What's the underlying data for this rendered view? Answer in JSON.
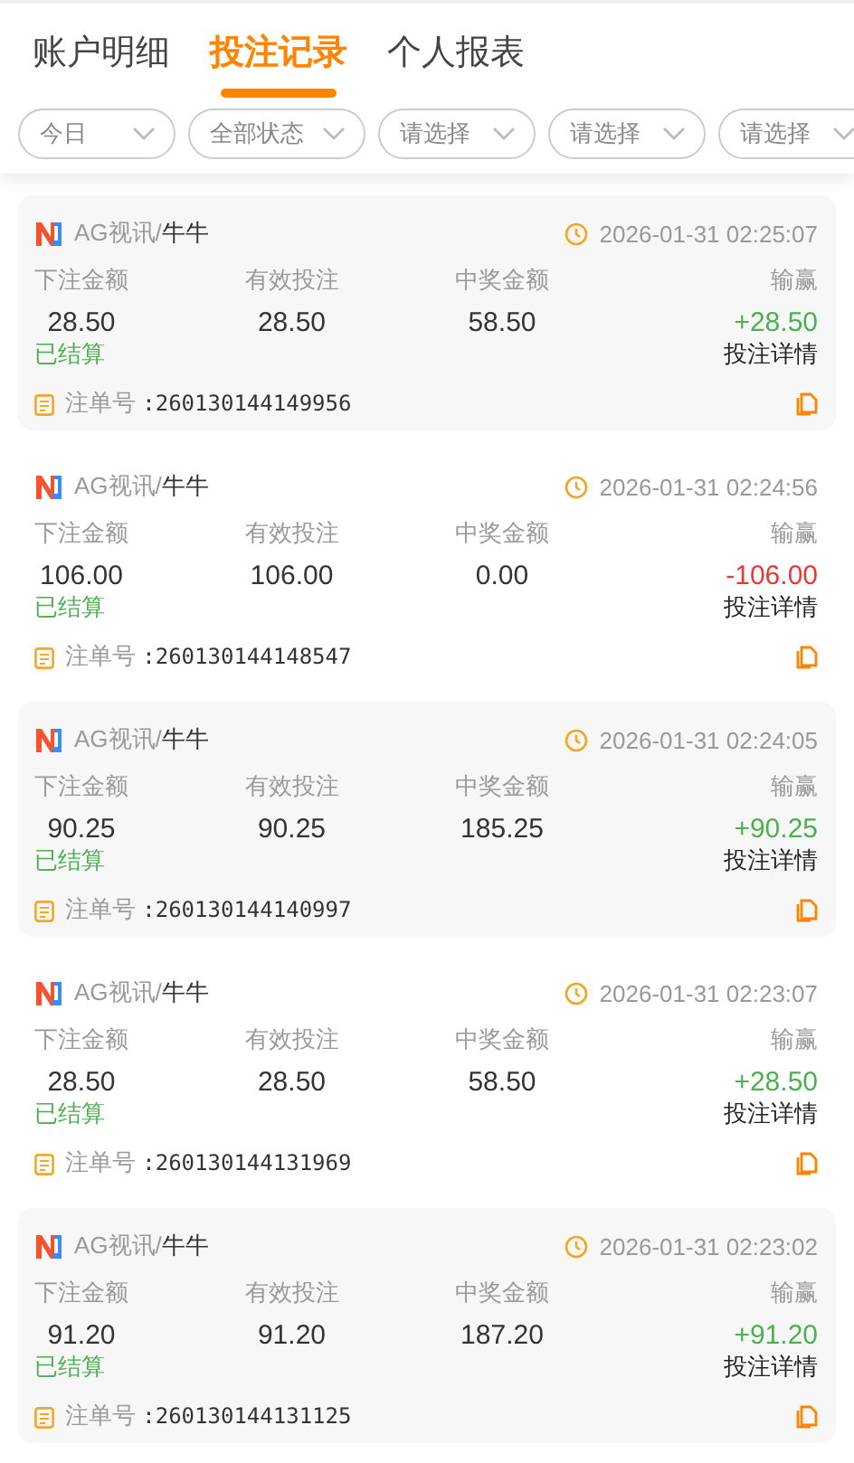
{
  "tabs": [
    {
      "label": "账户明细",
      "selected": false
    },
    {
      "label": "投注记录",
      "selected": true
    },
    {
      "label": "个人报表",
      "selected": false
    }
  ],
  "filters": [
    "今日",
    "全部状态",
    "请选择",
    "请选择",
    "请选择"
  ],
  "records": [
    {
      "game": "AG视讯/",
      "table": "牛牛",
      "time": "2026-01-31 02:25:07",
      "labels": [
        "下注金额",
        "有效投注",
        "中奖金额",
        "输赢"
      ],
      "bet": "28.50",
      "valid": "28.50",
      "payout": "58.50",
      "result": "+28.50",
      "kind": "win",
      "status": "已结算",
      "detail": "投注详情",
      "order_label": "注单号",
      "order_no": ":260130144149956"
    },
    {
      "game": "AG视讯/",
      "table": "牛牛",
      "time": "2026-01-31 02:24:56",
      "labels": [
        "下注金额",
        "有效投注",
        "中奖金额",
        "输赢"
      ],
      "bet": "106.00",
      "valid": "106.00",
      "payout": "0.00",
      "result": "-106.00",
      "kind": "loss",
      "status": "已结算",
      "detail": "投注详情",
      "order_label": "注单号",
      "order_no": ":260130144148547"
    },
    {
      "game": "AG视讯/",
      "table": "牛牛",
      "time": "2026-01-31 02:24:05",
      "labels": [
        "下注金额",
        "有效投注",
        "中奖金额",
        "输赢"
      ],
      "bet": "90.25",
      "valid": "90.25",
      "payout": "185.25",
      "result": "+90.25",
      "kind": "win",
      "status": "已结算",
      "detail": "投注详情",
      "order_label": "注单号",
      "order_no": ":260130144140997"
    },
    {
      "game": "AG视讯/",
      "table": "牛牛",
      "time": "2026-01-31 02:23:07",
      "labels": [
        "下注金额",
        "有效投注",
        "中奖金额",
        "输赢"
      ],
      "bet": "28.50",
      "valid": "28.50",
      "payout": "58.50",
      "result": "+28.50",
      "kind": "win",
      "status": "已结算",
      "detail": "投注详情",
      "order_label": "注单号",
      "order_no": ":260130144131969"
    },
    {
      "game": "AG视讯/",
      "table": "牛牛",
      "time": "2026-01-31 02:23:02",
      "labels": [
        "下注金额",
        "有效投注",
        "中奖金额",
        "输赢"
      ],
      "bet": "91.20",
      "valid": "91.20",
      "payout": "187.20",
      "result": "+91.20",
      "kind": "win",
      "status": "已结算",
      "detail": "投注详情",
      "order_label": "注单号",
      "order_no": ":260130144131125"
    }
  ]
}
